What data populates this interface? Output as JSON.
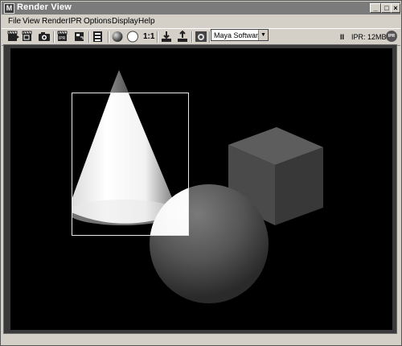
{
  "window": {
    "title": "Render View",
    "app_icon_letter": "M"
  },
  "window_controls": {
    "minimize": "_",
    "maximize": "□",
    "close": "×"
  },
  "menu": [
    "File",
    "View",
    "Render",
    "IPR",
    "Options",
    "Display",
    "Help"
  ],
  "toolbar": {
    "ratio_label": "1:1",
    "renderer_selected": "Maya Software",
    "ipr_memory": "IPR: 12MB",
    "pause_symbol": "II",
    "ipr_badge": "IPR",
    "icons": [
      "redo-render-icon",
      "render-region-icon",
      "snapshot-icon",
      "ipr-render-icon",
      "refresh-ipr-icon",
      "render-settings-icon",
      "display-rgb-icon",
      "display-alpha-icon",
      "keep-image-icon",
      "remove-image-icon",
      "render-layer-icon"
    ]
  },
  "scene": {
    "objects": [
      "cone",
      "cube",
      "sphere"
    ],
    "render_region": true
  }
}
